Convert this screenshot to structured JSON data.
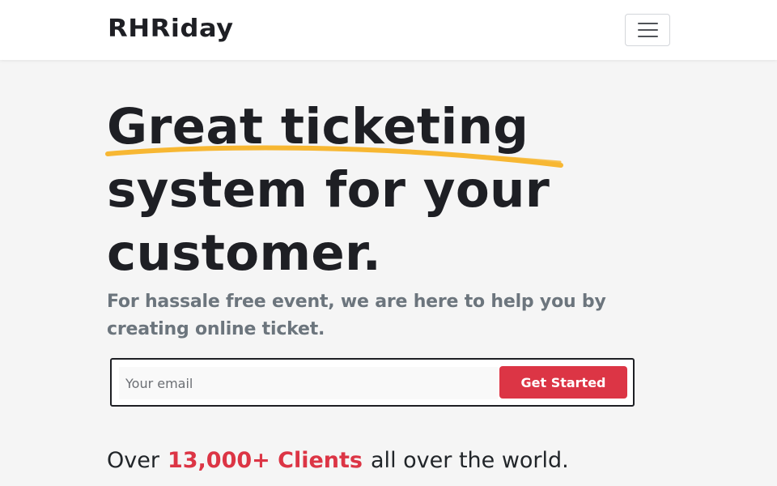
{
  "navbar": {
    "brand": "RHRiday",
    "toggler_icon": "hamburger-menu-icon"
  },
  "hero": {
    "title_lines": [
      "Great ticketing",
      "system for your",
      "customer."
    ],
    "underline_color": "#f7b733",
    "lead": "For hassale free event, we are here to help you by creating online ticket."
  },
  "signup": {
    "email_placeholder": "Your email",
    "email_value": "",
    "button_label": "Get Started"
  },
  "clients": {
    "prefix": "Over",
    "highlight": "13,000+ Clients",
    "suffix": "all over the world."
  },
  "colors": {
    "accent": "#dc3545",
    "underline": "#f7b733",
    "text": "#212529",
    "muted": "#6c757d",
    "background": "#f5f5f5"
  }
}
